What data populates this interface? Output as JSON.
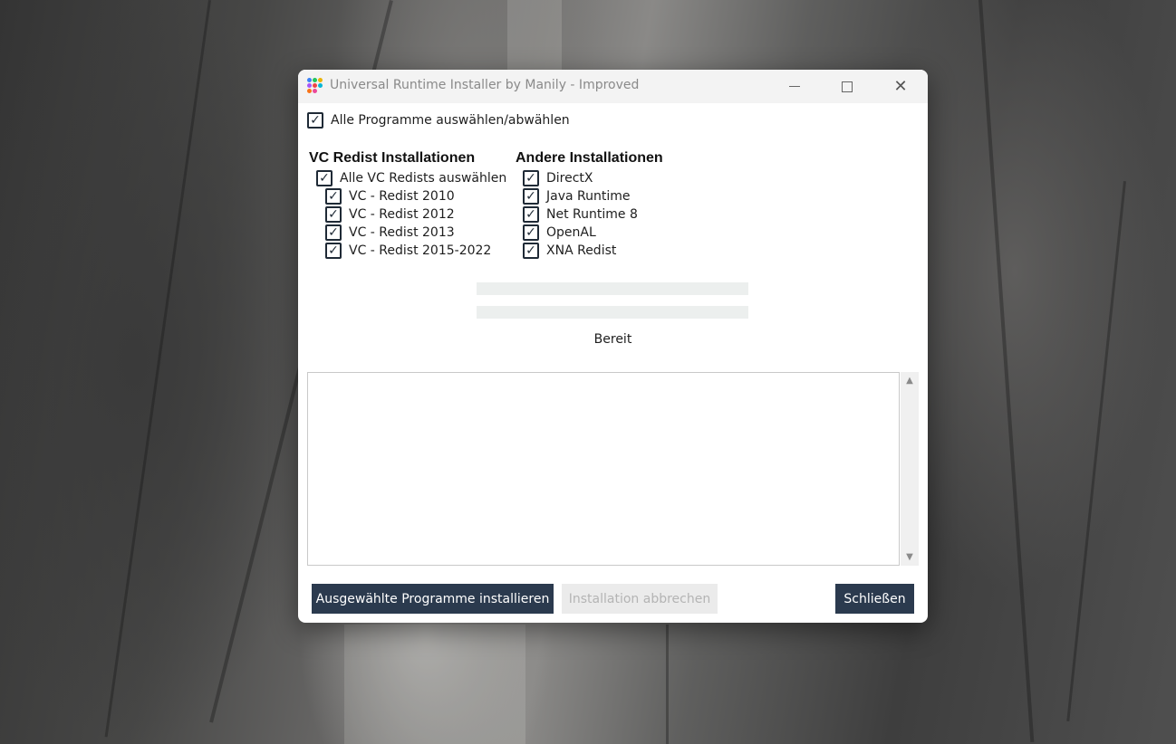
{
  "window": {
    "title": "Universal Runtime Installer by Manily - Improved",
    "controls": {
      "minimize": "—",
      "close": "✕"
    }
  },
  "select_all": {
    "label": "Alle Programme auswählen/abwählen",
    "checked": true
  },
  "vc_section": {
    "title": "VC Redist Installationen",
    "select_all_label": "Alle VC Redists auswählen",
    "items": [
      {
        "label": "VC - Redist 2010",
        "checked": true
      },
      {
        "label": "VC - Redist 2012",
        "checked": true
      },
      {
        "label": "VC - Redist 2013",
        "checked": true
      },
      {
        "label": "VC - Redist 2015-2022",
        "checked": true
      }
    ]
  },
  "other_section": {
    "title": "Andere Installationen",
    "items": [
      {
        "label": "DirectX",
        "checked": true
      },
      {
        "label": "Java Runtime",
        "checked": true
      },
      {
        "label": "Net Runtime 8",
        "checked": true
      },
      {
        "label": "OpenAL",
        "checked": true
      },
      {
        "label": "XNA Redist",
        "checked": true
      }
    ]
  },
  "progress": {
    "overall": 0,
    "current": 0
  },
  "status": "Bereit",
  "scrollbar": {
    "up": "▲",
    "down": "▼"
  },
  "buttons": {
    "install": "Ausgewählte Programme installieren",
    "cancel": "Installation abbrechen",
    "close": "Schließen"
  },
  "check_glyph": "✓",
  "colors": {
    "accent": "#2b3a4e",
    "disabled_bg": "#ebebeb",
    "disabled_text": "#b4b4b4"
  }
}
